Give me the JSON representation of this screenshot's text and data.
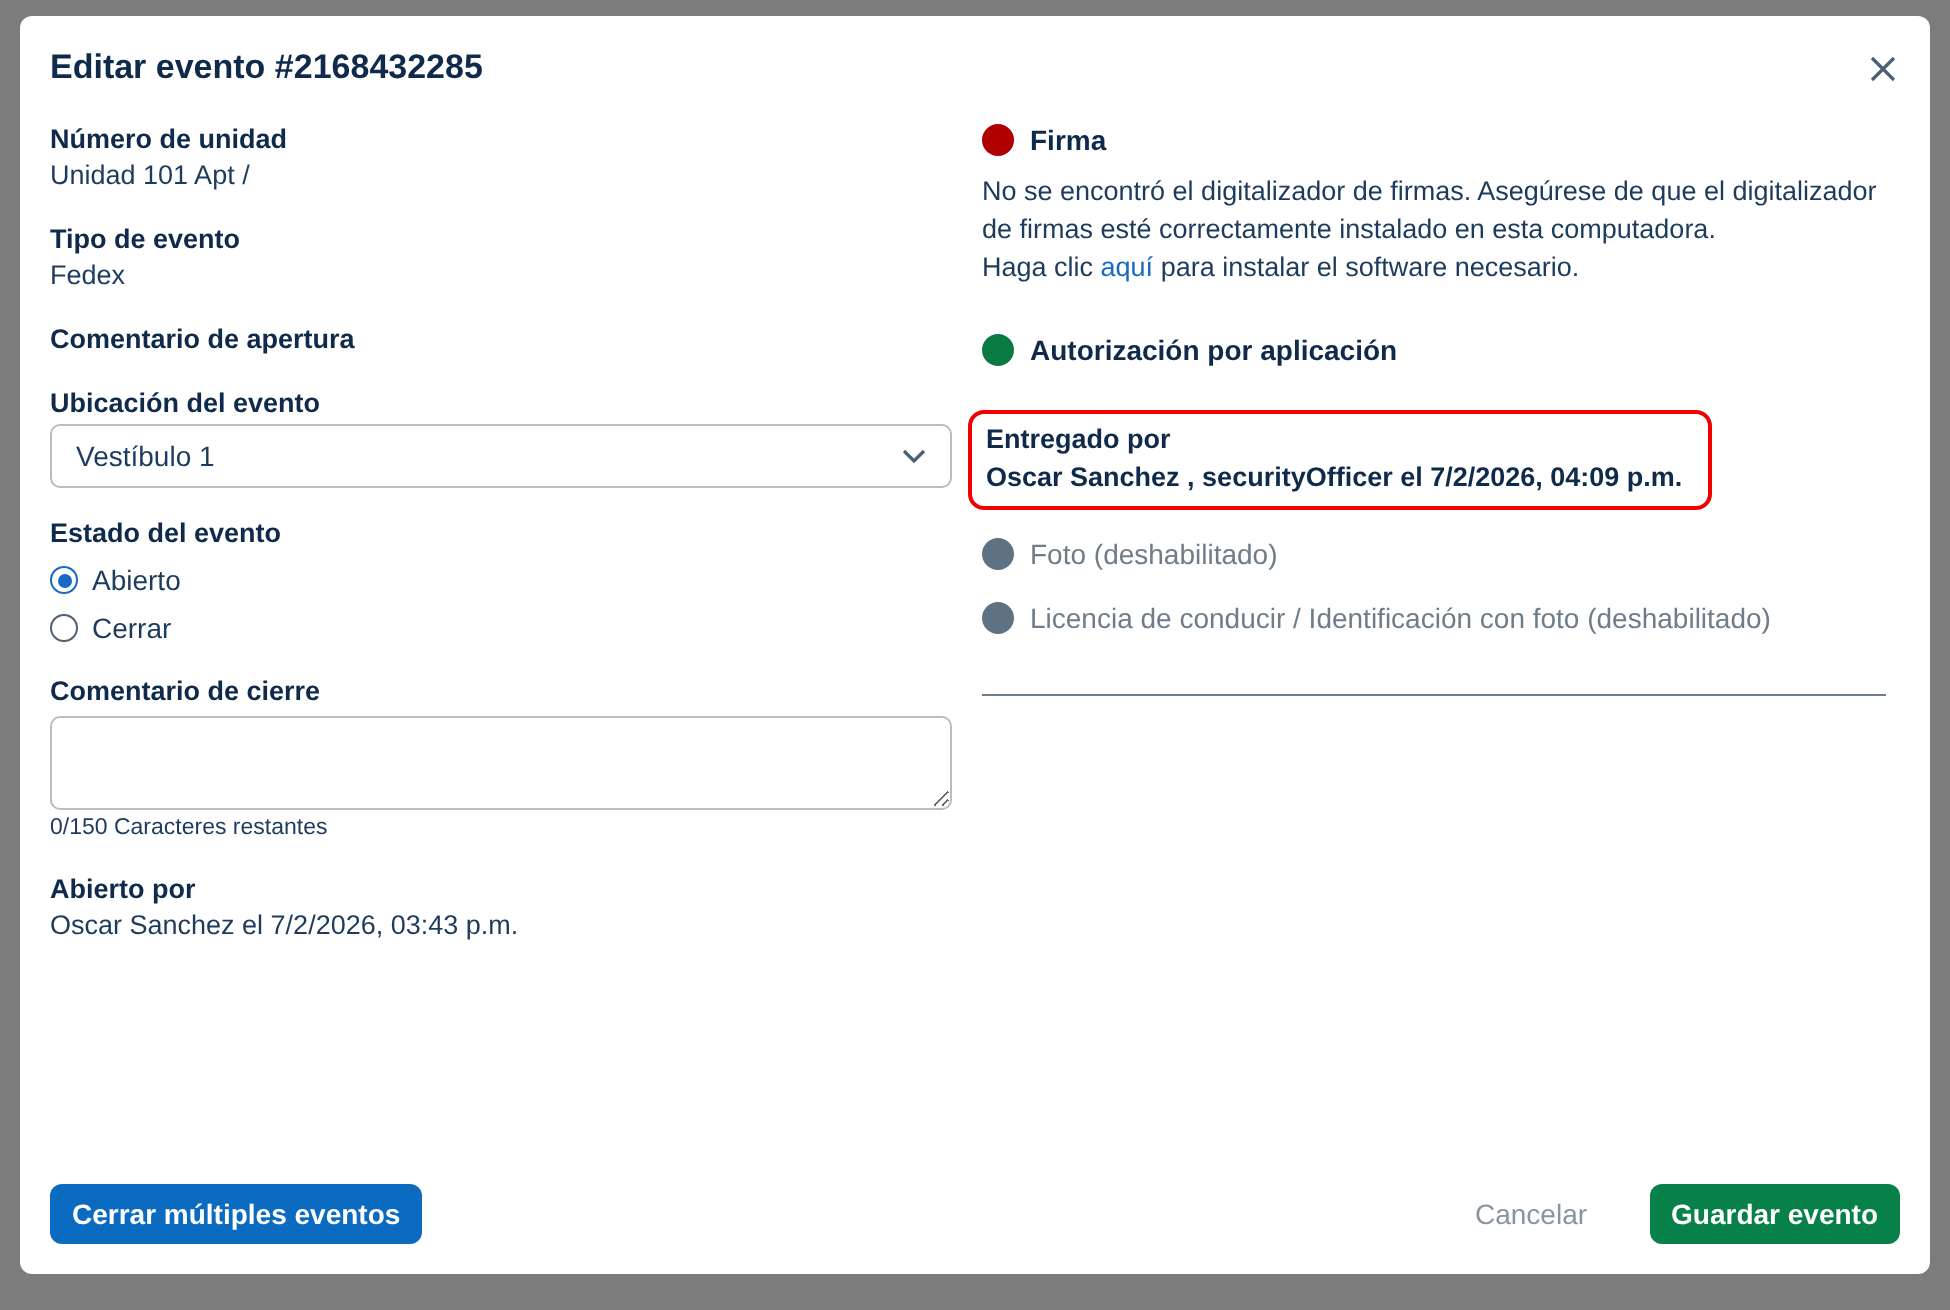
{
  "dialog": {
    "title": "Editar evento #2168432285"
  },
  "left": {
    "unit": {
      "label": "Número de unidad",
      "value": "Unidad 101 Apt /"
    },
    "event_type": {
      "label": "Tipo de evento",
      "value": "Fedex"
    },
    "opening_comment": {
      "label": "Comentario de apertura"
    },
    "location": {
      "label": "Ubicación del evento",
      "value": "Vestíbulo 1"
    },
    "status": {
      "label": "Estado del evento",
      "options": [
        {
          "label": "Abierto",
          "selected": true
        },
        {
          "label": "Cerrar",
          "selected": false
        }
      ]
    },
    "closing_comment": {
      "label": "Comentario de cierre",
      "counter": "0/150 Caracteres restantes"
    },
    "opened_by": {
      "label": "Abierto por",
      "value": "Oscar Sanchez el 7/2/2026, 03:43 p.m."
    }
  },
  "right": {
    "items": [
      {
        "kind": "status",
        "label": "Firma",
        "color": "#b00000",
        "disabled": false,
        "message": "No se encontró el digitalizador de firmas. Asegúrese de que el digitalizador de firmas esté correctamente instalado en esta computadora.",
        "link_prefix": "Haga clic ",
        "link": "aquí",
        "link_suffix": " para instalar el software necesario."
      },
      {
        "kind": "status",
        "label": "Autorización por aplicación",
        "color": "#0a7a45",
        "disabled": false
      },
      {
        "kind": "info",
        "label": "Entregado por",
        "value": "Oscar Sanchez , securityOfficer el 7/2/2026, 04:09 p.m.",
        "highlighted": true
      },
      {
        "kind": "status",
        "label": "Foto (deshabilitado)",
        "color": "#5f7282",
        "disabled": true
      },
      {
        "kind": "status",
        "label": "Licencia de conducir / Identificación con foto (deshabilitado)",
        "color": "#5f7282",
        "disabled": true
      }
    ]
  },
  "footer": {
    "left_button": "Cerrar múltiples eventos",
    "cancel": "Cancelar",
    "save": "Guardar evento"
  }
}
